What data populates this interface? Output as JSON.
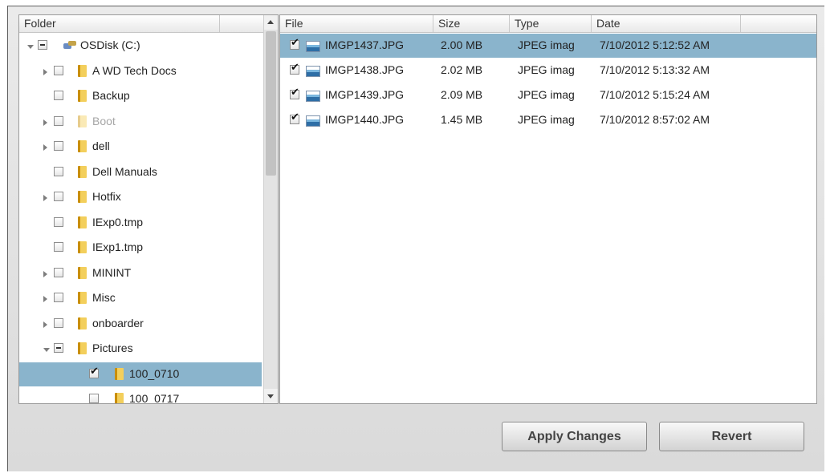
{
  "folder_panel": {
    "header": "Folder",
    "tree": [
      {
        "label": "OSDisk (C:)",
        "level": 0,
        "expander": "open",
        "check": "partial",
        "icon": "drive-icon",
        "dim": false,
        "selected": false
      },
      {
        "label": "A WD Tech Docs",
        "level": 1,
        "expander": "closed",
        "check": "unchecked",
        "icon": "folder-icon",
        "dim": false,
        "selected": false
      },
      {
        "label": "Backup",
        "level": 1,
        "expander": "none",
        "check": "unchecked",
        "icon": "folder-icon",
        "dim": false,
        "selected": false
      },
      {
        "label": "Boot",
        "level": 1,
        "expander": "closed",
        "check": "unchecked",
        "icon": "folder-icon",
        "dim": true,
        "selected": false
      },
      {
        "label": "dell",
        "level": 1,
        "expander": "closed",
        "check": "unchecked",
        "icon": "folder-icon",
        "dim": false,
        "selected": false
      },
      {
        "label": "Dell Manuals",
        "level": 1,
        "expander": "none",
        "check": "unchecked",
        "icon": "folder-icon",
        "dim": false,
        "selected": false
      },
      {
        "label": "Hotfix",
        "level": 1,
        "expander": "closed",
        "check": "unchecked",
        "icon": "folder-icon",
        "dim": false,
        "selected": false
      },
      {
        "label": "IExp0.tmp",
        "level": 1,
        "expander": "none",
        "check": "unchecked",
        "icon": "folder-icon",
        "dim": false,
        "selected": false
      },
      {
        "label": "IExp1.tmp",
        "level": 1,
        "expander": "none",
        "check": "unchecked",
        "icon": "folder-icon",
        "dim": false,
        "selected": false
      },
      {
        "label": "MININT",
        "level": 1,
        "expander": "closed",
        "check": "unchecked",
        "icon": "folder-icon",
        "dim": false,
        "selected": false
      },
      {
        "label": "Misc",
        "level": 1,
        "expander": "closed",
        "check": "unchecked",
        "icon": "folder-icon",
        "dim": false,
        "selected": false
      },
      {
        "label": "onboarder",
        "level": 1,
        "expander": "closed",
        "check": "unchecked",
        "icon": "folder-icon",
        "dim": false,
        "selected": false
      },
      {
        "label": "Pictures",
        "level": 1,
        "expander": "open",
        "check": "partial",
        "icon": "folder-icon",
        "dim": false,
        "selected": false
      },
      {
        "label": "100_0710",
        "level": 2,
        "expander": "none",
        "check": "checked",
        "icon": "folder-icon",
        "dim": false,
        "selected": true
      },
      {
        "label": "100_0717",
        "level": 2,
        "expander": "none",
        "check": "unchecked",
        "icon": "folder-icon",
        "dim": false,
        "selected": false
      }
    ]
  },
  "file_panel": {
    "columns": {
      "file": "File",
      "size": "Size",
      "type": "Type",
      "date": "Date"
    },
    "rows": [
      {
        "name": "IMGP1437.JPG",
        "size": "2.00 MB",
        "type": "JPEG imag",
        "date": "7/10/2012 5:12:52 AM",
        "checked": true,
        "selected": true
      },
      {
        "name": "IMGP1438.JPG",
        "size": "2.02 MB",
        "type": "JPEG imag",
        "date": "7/10/2012 5:13:32 AM",
        "checked": true,
        "selected": false
      },
      {
        "name": "IMGP1439.JPG",
        "size": "2.09 MB",
        "type": "JPEG imag",
        "date": "7/10/2012 5:15:24 AM",
        "checked": true,
        "selected": false
      },
      {
        "name": "IMGP1440.JPG",
        "size": "1.45 MB",
        "type": "JPEG imag",
        "date": "7/10/2012 8:57:02 AM",
        "checked": true,
        "selected": false
      }
    ]
  },
  "buttons": {
    "apply": "Apply Changes",
    "revert": "Revert"
  },
  "colors": {
    "selection": "#8ab4cc",
    "folder": "#f3cf5c"
  }
}
